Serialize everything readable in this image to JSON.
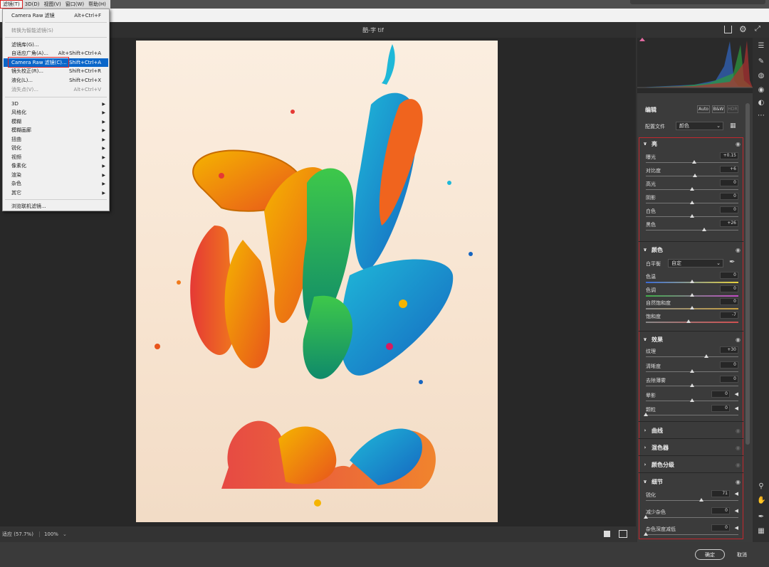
{
  "menubar": {
    "items": [
      "滤镜(T)",
      "3D(D)",
      "视图(V)",
      "窗口(W)",
      "帮助(H)"
    ]
  },
  "document": {
    "title": "酷-字 tif"
  },
  "filter_menu": {
    "items": [
      {
        "label": "Camera Raw 滤镜",
        "shortcut": "Alt+Ctrl+F"
      },
      {
        "label": "转换为智能滤镜(S)",
        "shortcut": "",
        "disabled": true
      },
      {
        "label": "滤镜库(G)...",
        "shortcut": ""
      },
      {
        "label": "自适应广角(A)...",
        "shortcut": "Alt+Shift+Ctrl+A"
      },
      {
        "label": "Camera Raw 滤镜(C)...",
        "shortcut": "Shift+Ctrl+A",
        "highlighted": true
      },
      {
        "label": "镜头校正(R)...",
        "shortcut": "Shift+Ctrl+R"
      },
      {
        "label": "液化(L)...",
        "shortcut": "Shift+Ctrl+X"
      },
      {
        "label": "消失点(V)...",
        "shortcut": "Alt+Ctrl+V",
        "disabled": true
      },
      {
        "label": "3D",
        "submenu": true
      },
      {
        "label": "风格化",
        "submenu": true
      },
      {
        "label": "模糊",
        "submenu": true
      },
      {
        "label": "模糊画廊",
        "submenu": true
      },
      {
        "label": "扭曲",
        "submenu": true
      },
      {
        "label": "锐化",
        "submenu": true
      },
      {
        "label": "视频",
        "submenu": true
      },
      {
        "label": "像素化",
        "submenu": true
      },
      {
        "label": "渲染",
        "submenu": true
      },
      {
        "label": "杂色",
        "submenu": true
      },
      {
        "label": "其它",
        "submenu": true
      },
      {
        "label": "浏览联机滤镜...",
        "shortcut": ""
      }
    ]
  },
  "status": {
    "fit": "适应 (57.7%)",
    "zoom": "100%"
  },
  "panel": {
    "edit_title": "编辑",
    "auto_label": "Auto",
    "bw_label": "B&W",
    "hdr_label": "HDR",
    "profile_label": "配置文件",
    "profile_value": "颜色",
    "light": {
      "title": "亮",
      "rows": [
        {
          "label": "曝光",
          "value": "+0.15",
          "pos": 0.52
        },
        {
          "label": "对比度",
          "value": "+6",
          "pos": 0.53
        },
        {
          "label": "高光",
          "value": "0",
          "pos": 0.5
        },
        {
          "label": "阴影",
          "value": "0",
          "pos": 0.5
        },
        {
          "label": "白色",
          "value": "0",
          "pos": 0.5
        },
        {
          "label": "黑色",
          "value": "+26",
          "pos": 0.63
        }
      ]
    },
    "color": {
      "title": "颜色",
      "wb_label": "白平衡",
      "wb_value": "自定",
      "rows": [
        {
          "label": "色温",
          "value": "0",
          "pos": 0.5
        },
        {
          "label": "色调",
          "value": "0",
          "pos": 0.5
        },
        {
          "label": "自然饱和度",
          "value": "0",
          "pos": 0.5
        },
        {
          "label": "饱和度",
          "value": "-7",
          "pos": 0.46
        }
      ]
    },
    "effects": {
      "title": "效果",
      "rows": [
        {
          "label": "纹理",
          "value": "+30",
          "pos": 0.65
        },
        {
          "label": "清晰度",
          "value": "0",
          "pos": 0.5
        },
        {
          "label": "去除薄雾",
          "value": "0",
          "pos": 0.5
        },
        {
          "label": "晕影",
          "value": "0",
          "pos": 0.5
        },
        {
          "label": "颗粒",
          "value": "0",
          "pos": 0.0
        }
      ]
    },
    "collapsed": [
      "曲线",
      "混色器",
      "颜色分级"
    ],
    "detail": {
      "title": "细节",
      "rows": [
        {
          "label": "锐化",
          "value": "71",
          "pos": 0.6
        },
        {
          "label": "减少杂色",
          "value": "0",
          "pos": 0.0
        },
        {
          "label": "杂色深度减低",
          "value": "0",
          "pos": 0.0
        }
      ]
    }
  },
  "buttons": {
    "ok": "确定",
    "cancel": "取消"
  }
}
